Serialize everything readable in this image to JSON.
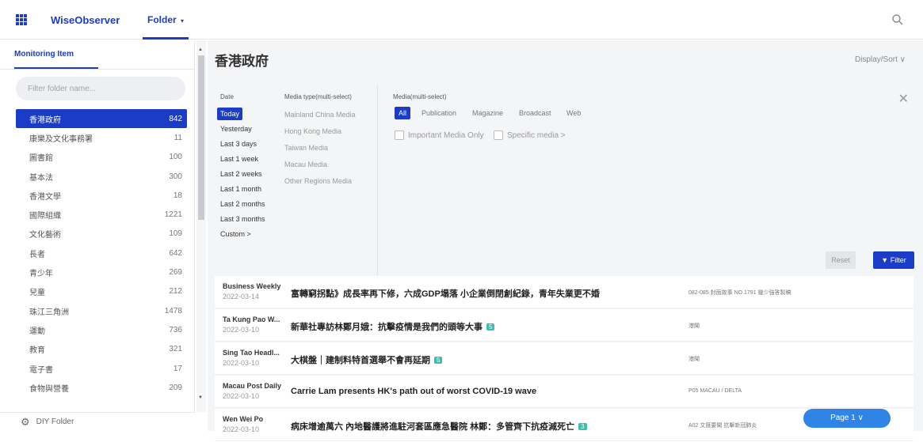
{
  "topbar": {
    "brand": "WiseObserver",
    "folder_menu": "Folder",
    "folder_caret": "▾"
  },
  "sidebar": {
    "tab": "Monitoring Item",
    "filter_placeholder": "Filter folder name...",
    "items": [
      {
        "label": "香港政府",
        "count": "842"
      },
      {
        "label": "康樂及文化事務署",
        "count": "11"
      },
      {
        "label": "圖書館",
        "count": "100"
      },
      {
        "label": "基本法",
        "count": "300"
      },
      {
        "label": "香港文學",
        "count": "18"
      },
      {
        "label": "國際組織",
        "count": "1221"
      },
      {
        "label": "文化藝術",
        "count": "109"
      },
      {
        "label": "長者",
        "count": "642"
      },
      {
        "label": "青少年",
        "count": "269"
      },
      {
        "label": "兒童",
        "count": "212"
      },
      {
        "label": "珠江三角洲",
        "count": "1478"
      },
      {
        "label": "運動",
        "count": "736"
      },
      {
        "label": "教育",
        "count": "321"
      },
      {
        "label": "電子書",
        "count": "17"
      },
      {
        "label": "食物與營養",
        "count": "209"
      }
    ],
    "diy_folder": "DIY Folder"
  },
  "main": {
    "title": "香港政府",
    "display_sort": "Display/Sort ∨"
  },
  "filters": {
    "date_head": "Date",
    "date_options": [
      "Today",
      "Yesterday",
      "Last 3 days",
      "Last 1 week",
      "Last 2 weeks",
      "Last 1 month",
      "Last 2 months",
      "Last 3 months",
      "Custom  >"
    ],
    "media_type_head": "Media type(multi-select)",
    "media_types": [
      "Mainland China Media",
      "Hong Kong Media",
      "Taiwan Media",
      "Macau Media",
      "Other Regions Media"
    ],
    "media_head": "Media(multi-select)",
    "media_tabs": [
      "All",
      "Publication",
      "Magazine",
      "Broadcast",
      "Web"
    ],
    "important_only": "Important Media Only",
    "specific_media": "Specific media  >",
    "reset": "Reset",
    "filter": "Filter"
  },
  "results": [
    {
      "source": "Business Weekly",
      "date": "2022-03-14",
      "headline": "富轉窮拐點》成長率再下修，六成GDP塌落 小企業倒閉創紀錄，青年失業更不婚",
      "badge": "",
      "meta": "082-085 封面故事 NO.1791 幾少強答製稿"
    },
    {
      "source": "Ta Kung Pao W...",
      "date": "2022-03-10",
      "headline": "新華社專訪林鄭月娥：抗擊疫情是我們的頭等大事",
      "badge": "5",
      "meta": "港聞"
    },
    {
      "source": "Sing Tao Headl...",
      "date": "2022-03-10",
      "headline": "大棋盤｜建制料特首選舉不會再延期",
      "badge": "5",
      "meta": "港聞"
    },
    {
      "source": "Macau Post Daily",
      "date": "2022-03-10",
      "headline": "Carrie Lam presents HK's path out of worst COVID-19 wave",
      "badge": "",
      "meta": "P05 MACAU / DELTA"
    },
    {
      "source": "Wen Wei Po",
      "date": "2022-03-10",
      "headline": "病床增逾萬六 內地醫護將進駐河套區應急醫院 林鄭：多管齊下抗疫減死亡",
      "badge": "3",
      "meta": "A02 文匯要聞 抗擊新冠肺炎"
    }
  ],
  "pagination": {
    "label": "Page 1  ∨"
  },
  "colors": {
    "accent": "#1a3cc7",
    "page_button": "#2f84e6",
    "badge": "#3cbdb0"
  }
}
